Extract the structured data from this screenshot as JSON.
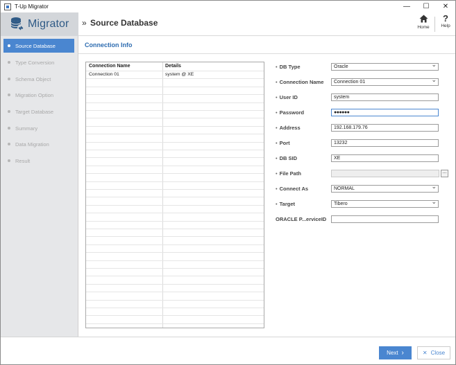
{
  "window": {
    "title": "T-Up Migrator",
    "controls": {
      "minimize": "—",
      "maximize": "☐",
      "close": "✕"
    }
  },
  "header": {
    "logo_text": "Migrator",
    "page_title": "Source Database",
    "page_title_prefix": "»",
    "home_label": "Home",
    "help_label": "Help",
    "help_glyph": "?"
  },
  "sidebar": {
    "items": [
      {
        "label": "Source Database",
        "active": true
      },
      {
        "label": "Type Conversion",
        "active": false
      },
      {
        "label": "Schema Object",
        "active": false
      },
      {
        "label": "Migration Option",
        "active": false
      },
      {
        "label": "Target Database",
        "active": false
      },
      {
        "label": "Summary",
        "active": false
      },
      {
        "label": "Data Migration",
        "active": false
      },
      {
        "label": "Result",
        "active": false
      }
    ]
  },
  "main": {
    "section_title": "Connection Info",
    "table": {
      "columns": [
        "Connection Name",
        "Details"
      ],
      "rows": [
        [
          "Connection 01",
          "system @ XE"
        ]
      ]
    },
    "form": {
      "bullet": "•",
      "fields": [
        {
          "label": "DB Type",
          "value": "Oracle",
          "type": "select"
        },
        {
          "label": "Connection Name",
          "value": "Connection 01",
          "type": "select"
        },
        {
          "label": "User ID",
          "value": "system",
          "type": "text"
        },
        {
          "label": "Password",
          "value": "●●●●●●",
          "type": "password"
        },
        {
          "label": "Address",
          "value": "192.168.179.76",
          "type": "text"
        },
        {
          "label": "Port",
          "value": "13232",
          "type": "text"
        },
        {
          "label": "DB SID",
          "value": "XE",
          "type": "text"
        },
        {
          "label": "File Path",
          "value": "",
          "type": "file"
        },
        {
          "label": "Connect As",
          "value": "NORMAL",
          "type": "select"
        },
        {
          "label": "Target",
          "value": "Tibero",
          "type": "select"
        },
        {
          "label": "ORACLE P...erviceID",
          "value": "",
          "type": "text"
        }
      ],
      "browse_label": "..."
    }
  },
  "footer": {
    "next_label": "Next",
    "next_glyph": "›",
    "close_label": "Close",
    "close_glyph": "✕"
  },
  "colors": {
    "accent": "#4a86d0",
    "section_title": "#2e6cb0",
    "logo": "#2f5a86",
    "sidebar_bg": "#e6e7e9"
  }
}
